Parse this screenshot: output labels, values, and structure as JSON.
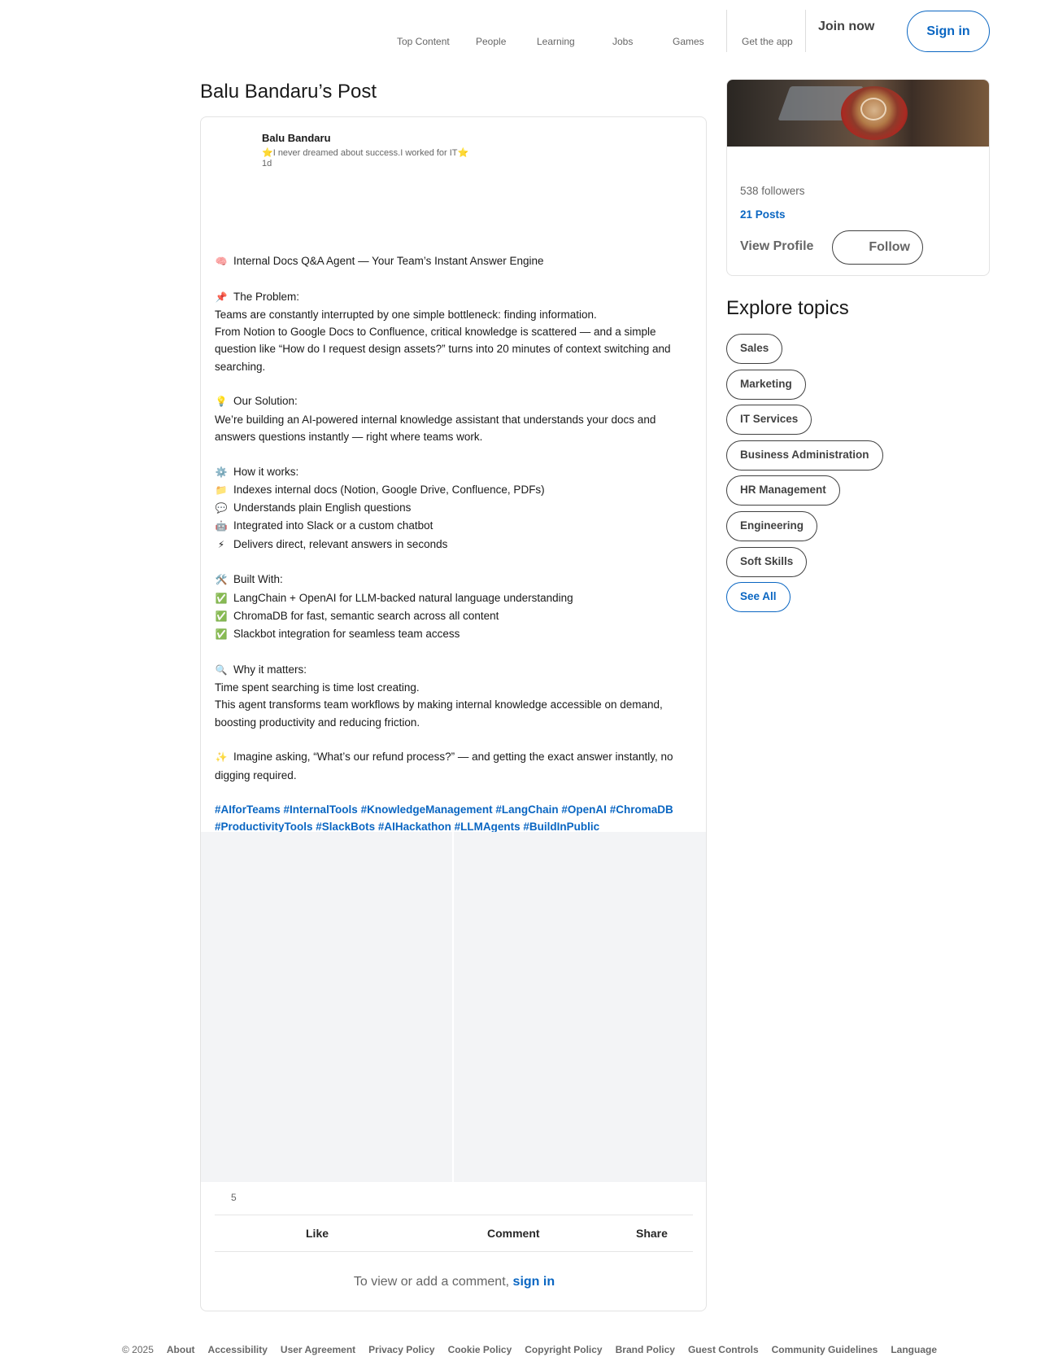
{
  "nav": {
    "items": [
      {
        "label": "Top Content"
      },
      {
        "label": "People"
      },
      {
        "label": "Learning"
      },
      {
        "label": "Jobs"
      },
      {
        "label": "Games"
      },
      {
        "label": "Get the app"
      }
    ],
    "join_label": "Join now",
    "signin_label": "Sign in"
  },
  "page_title": "Balu Bandaru’s Post",
  "post": {
    "author_name": "Balu Bandaru",
    "author_headline_star_left": "⭐",
    "author_headline_text": "I never dreamed about success.I worked for IT",
    "author_headline_star_right": "⭐",
    "time": "1d",
    "lines": [
      {
        "emoji": "🧠",
        "text": "Internal Docs Q&A Agent — Your Team’s Instant Answer Engine"
      },
      {
        "emoji": "",
        "text": ""
      },
      {
        "emoji": "📌",
        "text": "The Problem:"
      },
      {
        "emoji": "",
        "text": "Teams are constantly interrupted by one simple bottleneck: finding information."
      },
      {
        "emoji": "",
        "text": "From Notion to Google Docs to Confluence, critical knowledge is scattered — and a simple question like “How do I request design assets?” turns into 20 minutes of context switching and searching."
      },
      {
        "emoji": "",
        "text": ""
      },
      {
        "emoji": "💡",
        "text": "Our Solution:"
      },
      {
        "emoji": "",
        "text": "We’re building an AI-powered internal knowledge assistant that understands your docs and answers questions instantly — right where teams work."
      },
      {
        "emoji": "",
        "text": ""
      },
      {
        "emoji": "⚙️",
        "text": "How it works:"
      },
      {
        "emoji": "📁",
        "text": "Indexes internal docs (Notion, Google Drive, Confluence, PDFs)"
      },
      {
        "emoji": "💬",
        "text": "Understands plain English questions"
      },
      {
        "emoji": "🤖",
        "text": "Integrated into Slack or a custom chatbot"
      },
      {
        "emoji": "⚡",
        "text": "Delivers direct, relevant answers in seconds"
      },
      {
        "emoji": "",
        "text": ""
      },
      {
        "emoji": "🛠️",
        "text": "Built With:"
      },
      {
        "emoji": "✅",
        "text": "LangChain + OpenAI for LLM-backed natural language understanding"
      },
      {
        "emoji": "✅",
        "text": "ChromaDB for fast, semantic search across all content"
      },
      {
        "emoji": "✅",
        "text": "Slackbot integration for seamless team access"
      },
      {
        "emoji": "",
        "text": ""
      },
      {
        "emoji": "🔍",
        "text": "Why it matters:"
      },
      {
        "emoji": "",
        "text": "Time spent searching is time lost creating."
      },
      {
        "emoji": "",
        "text": "This agent transforms team workflows by making internal knowledge accessible on demand, boosting productivity and reducing friction."
      },
      {
        "emoji": "",
        "text": ""
      },
      {
        "emoji": "✨",
        "text": "Imagine asking, “What’s our refund process?” — and getting the exact answer instantly, no digging required."
      }
    ],
    "hashtags": [
      "#AIforTeams",
      "#InternalTools",
      "#KnowledgeManagement",
      "#LangChain",
      "#OpenAI",
      "#ChromaDB",
      "#ProductivityTools",
      "#SlackBots",
      "#AIHackathon",
      "#LLMAgents",
      "#BuildInPublic"
    ],
    "reaction_count": "5",
    "actions": {
      "like": "Like",
      "comment": "Comment",
      "share": "Share"
    },
    "comment_prompt_text": "To view or add a comment,",
    "comment_prompt_link": "sign in"
  },
  "profile": {
    "followers": "538 followers",
    "posts": "21 Posts",
    "view_profile": "View Profile",
    "follow": "Follow"
  },
  "explore": {
    "title": "Explore topics",
    "topics": [
      "Sales",
      "Marketing",
      "IT Services",
      "Business Administration",
      "HR Management",
      "Engineering",
      "Soft Skills"
    ],
    "see_all": "See All"
  },
  "footer": {
    "copyright": "© 2025",
    "links": [
      "About",
      "Accessibility",
      "User Agreement",
      "Privacy Policy",
      "Cookie Policy",
      "Copyright Policy",
      "Brand Policy",
      "Guest Controls",
      "Community Guidelines",
      "Language"
    ]
  },
  "colors": {
    "brand_blue": "#0a66c2",
    "muted_text": "#666666",
    "border": "#e3e3e3"
  }
}
